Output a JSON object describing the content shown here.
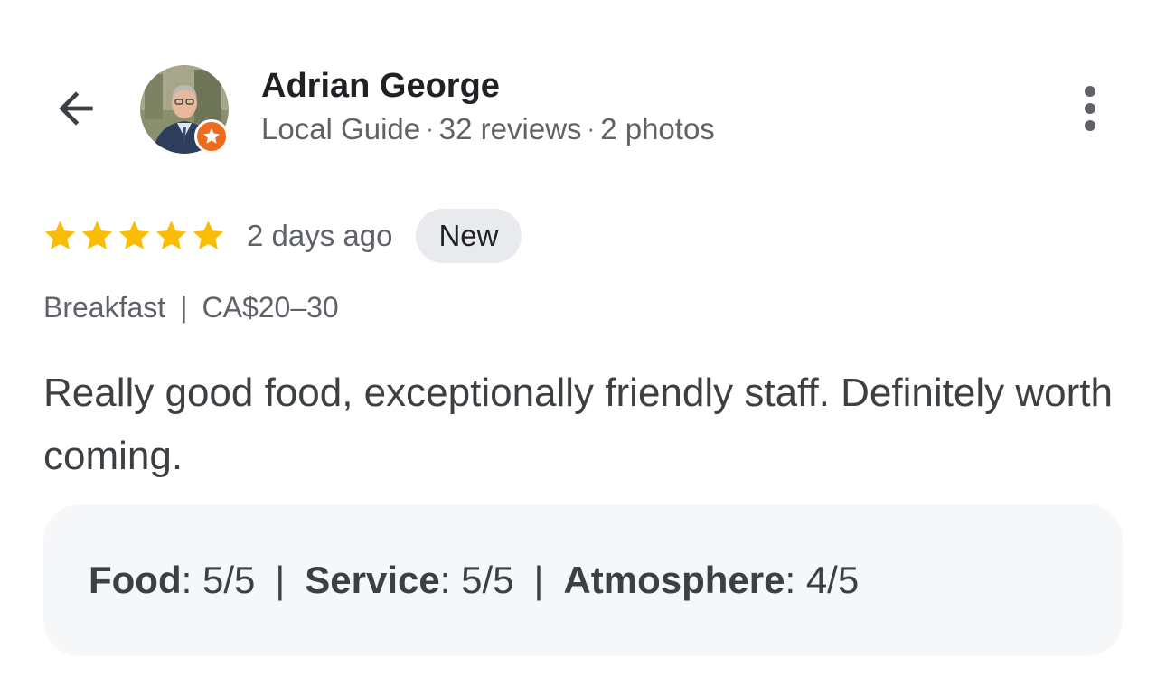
{
  "reviewer": {
    "name": "Adrian George",
    "level": "Local Guide",
    "reviews": "32 reviews",
    "photos": "2 photos",
    "separator": "·"
  },
  "review": {
    "rating": 5,
    "rating_max": 5,
    "time": "2 days ago",
    "badge": "New",
    "meal_type": "Breakfast",
    "price": "CA$20–30",
    "text": "Really good food, exceptionally friendly staff. Definitely worth coming."
  },
  "attributes": [
    {
      "label": "Food",
      "value": "5/5"
    },
    {
      "label": "Service",
      "value": "5/5"
    },
    {
      "label": "Atmosphere",
      "value": "4/5"
    }
  ],
  "separators": {
    "pipe": "|",
    "colon": ":"
  },
  "icons": {
    "back": "arrow-back-icon",
    "more": "more-vert-icon",
    "star": "star-icon",
    "guide_badge": "local-guide-star-icon"
  },
  "colors": {
    "star": "#fbbc04",
    "guide_badge": "#ee6a1c",
    "badge_bg": "#e8eaed",
    "attributes_bg": "#f5f7f9"
  }
}
